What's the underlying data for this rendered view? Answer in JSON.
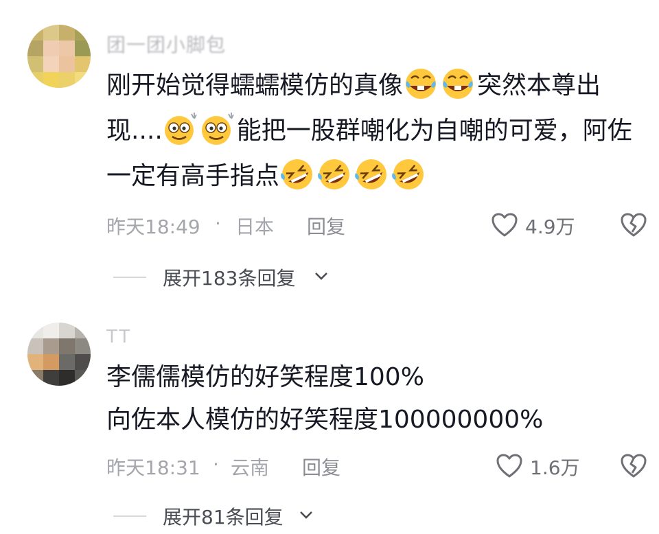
{
  "comments": [
    {
      "username": "团一团小脚包",
      "text_lines": [
        [
          "刚开始觉得蠕蠕模仿的真像",
          "[emoji:tears-of-joy-bucktooth]",
          "[emoji:tears-of-joy-bucktooth]",
          "突然本尊出"
        ],
        [
          "现....",
          "[emoji:dizzy-sweat]",
          "[emoji:dizzy-sweat]",
          "能把一股群嘲化为自嘲的可爱，阿佐"
        ],
        [
          "一定有高手指点",
          "[emoji:rolling-laugh]",
          "[emoji:rolling-laugh]",
          "[emoji:rolling-laugh]",
          "[emoji:rolling-laugh]"
        ]
      ],
      "line1_text": "刚开始觉得蠕蠕模仿的真像",
      "line1_tail": "突然本尊出",
      "line2_head": "现....",
      "line2_tail": "能把一股群嘲化为自嘲的可爱，阿佐",
      "line3_head": "一定有高手指点",
      "time": "昨天18:49",
      "separator": "·",
      "location": "日本",
      "reply_label": "回复",
      "like_count": "4.9万",
      "expand_label": "展开183条回复"
    },
    {
      "username": "TT",
      "line1": "李儒儒模仿的好笑程度100%",
      "line2": "向佐本人模仿的好笑程度100000000%",
      "time": "昨天18:31",
      "separator": "·",
      "location": "云南",
      "reply_label": "回复",
      "like_count": "1.6万",
      "expand_label": "展开81条回复"
    }
  ],
  "icons": {
    "like": "heart-outline-icon",
    "dislike": "broken-heart-icon",
    "expand": "chevron-down-icon"
  },
  "colors": {
    "text": "#161823",
    "meta": "#a4a6ab",
    "emoji_yellow": "#ffc83d"
  }
}
